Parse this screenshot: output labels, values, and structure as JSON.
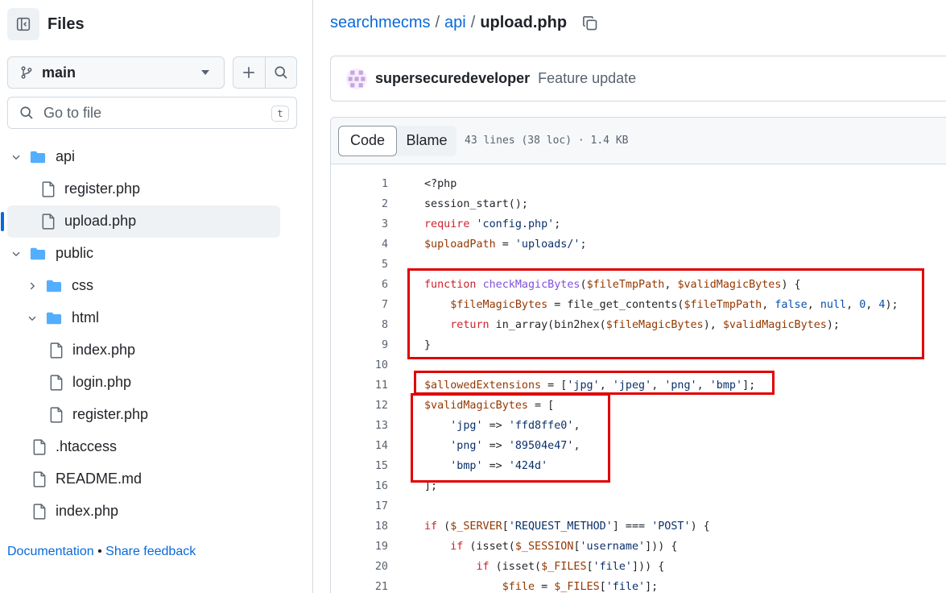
{
  "sidebar": {
    "title": "Files",
    "branch": "main",
    "go_to_file_placeholder": "Go to file",
    "go_to_file_shortcut": "t",
    "tree": [
      {
        "label": "api",
        "type": "folder",
        "expanded": true,
        "depth": 0
      },
      {
        "label": "register.php",
        "type": "file",
        "depth": 1
      },
      {
        "label": "upload.php",
        "type": "file",
        "depth": 1,
        "selected": true
      },
      {
        "label": "public",
        "type": "folder",
        "expanded": true,
        "depth": 0
      },
      {
        "label": "css",
        "type": "folder",
        "expanded": false,
        "depth": 1
      },
      {
        "label": "html",
        "type": "folder",
        "expanded": true,
        "depth": 1
      },
      {
        "label": "index.php",
        "type": "file",
        "depth": 2
      },
      {
        "label": "login.php",
        "type": "file",
        "depth": 2
      },
      {
        "label": "register.php",
        "type": "file",
        "depth": 2
      },
      {
        "label": ".htaccess",
        "type": "file",
        "depth": 0
      },
      {
        "label": "README.md",
        "type": "file",
        "depth": 0
      },
      {
        "label": "index.php",
        "type": "file",
        "depth": 0
      }
    ],
    "footer": {
      "documentation": "Documentation",
      "bullet": "•",
      "feedback": "Share feedback"
    }
  },
  "breadcrumb": {
    "repo": "searchmecms",
    "folder": "api",
    "file": "upload.php",
    "separator": "/"
  },
  "commit": {
    "author": "supersecuredeveloper",
    "message": "Feature update"
  },
  "code_view": {
    "tabs": {
      "code": "Code",
      "blame": "Blame"
    },
    "file_meta": "43 lines (38 loc) · 1.4 KB"
  },
  "colors": {
    "link": "#0969da",
    "highlight_box": "#e00000",
    "keyword": "#cf222e",
    "string": "#0a3069"
  },
  "code": [
    {
      "n": "1",
      "t": "<?php"
    },
    {
      "n": "2",
      "t": "session_start();"
    },
    {
      "n": "3",
      "t": "require 'config.php';"
    },
    {
      "n": "4",
      "t": "$uploadPath = 'uploads/';"
    },
    {
      "n": "5",
      "t": ""
    },
    {
      "n": "6",
      "t": "function checkMagicBytes($fileTmpPath, $validMagicBytes) {"
    },
    {
      "n": "7",
      "t": "    $fileMagicBytes = file_get_contents($fileTmpPath, false, null, 0, 4);"
    },
    {
      "n": "8",
      "t": "    return in_array(bin2hex($fileMagicBytes), $validMagicBytes);"
    },
    {
      "n": "9",
      "t": "}"
    },
    {
      "n": "10",
      "t": ""
    },
    {
      "n": "11",
      "t": "$allowedExtensions = ['jpg', 'jpeg', 'png', 'bmp'];"
    },
    {
      "n": "12",
      "t": "$validMagicBytes = ["
    },
    {
      "n": "13",
      "t": "    'jpg' => 'ffd8ffe0',"
    },
    {
      "n": "14",
      "t": "    'png' => '89504e47',"
    },
    {
      "n": "15",
      "t": "    'bmp' => '424d'"
    },
    {
      "n": "16",
      "t": "];"
    },
    {
      "n": "17",
      "t": ""
    },
    {
      "n": "18",
      "t": "if ($_SERVER['REQUEST_METHOD'] === 'POST') {"
    },
    {
      "n": "19",
      "t": "    if (isset($_SESSION['username'])) {"
    },
    {
      "n": "20",
      "t": "        if (isset($_FILES['file'])) {"
    },
    {
      "n": "21",
      "t": "            $file = $_FILES['file'];"
    }
  ]
}
